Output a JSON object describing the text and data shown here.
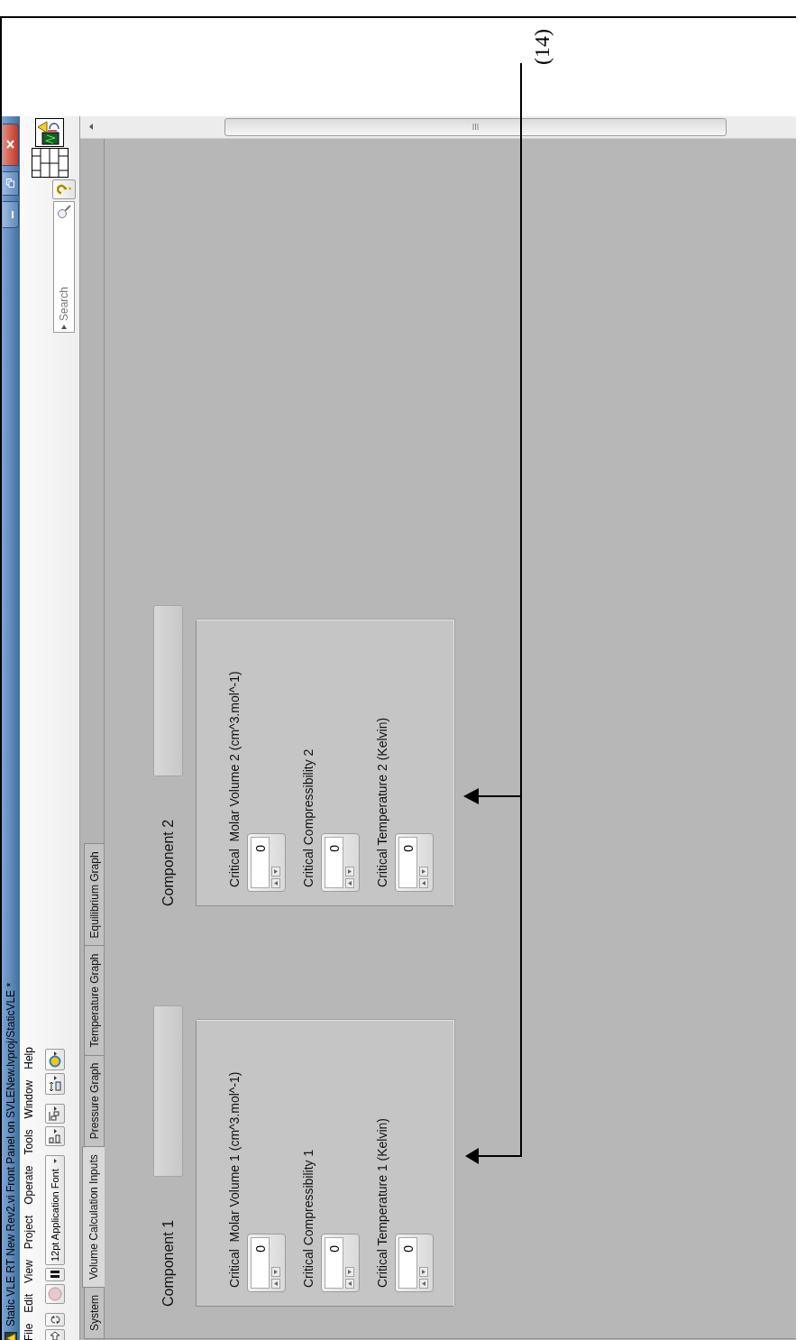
{
  "window": {
    "title": "Static VLE RT New Rev2.vi Front Panel on SVLENew.lvproj/StaticVLE *"
  },
  "menu": [
    "File",
    "Edit",
    "View",
    "Project",
    "Operate",
    "Tools",
    "Window",
    "Help"
  ],
  "toolbar": {
    "font": "12pt Application Font",
    "search": {
      "placeholder": "Search"
    }
  },
  "tabs": [
    {
      "label": "System",
      "selected": false
    },
    {
      "label": "Volume Calculation Inputs",
      "selected": true
    },
    {
      "label": "Pressure Graph",
      "selected": false
    },
    {
      "label": "Temperature Graph",
      "selected": false
    },
    {
      "label": "Equilibrium Graph",
      "selected": false
    }
  ],
  "components": [
    {
      "label": "Component 1",
      "fields": [
        {
          "label": "Critical  Molar Volume 1 (cm^3.mol^-1)",
          "value": "0"
        },
        {
          "label": "Critical Compressibility 1",
          "value": "0"
        },
        {
          "label": "Critical Temperature 1 (Kelvin)",
          "value": "0"
        }
      ]
    },
    {
      "label": "Component 2",
      "fields": [
        {
          "label": "Critical  Molar Volume 2 (cm^3.mol^-1)",
          "value": "0"
        },
        {
          "label": "Critical Compressibility 2",
          "value": "0"
        },
        {
          "label": "Critical Temperature 2 (Kelvin)",
          "value": "0"
        }
      ]
    }
  ],
  "annotation": {
    "label": "(14)"
  }
}
